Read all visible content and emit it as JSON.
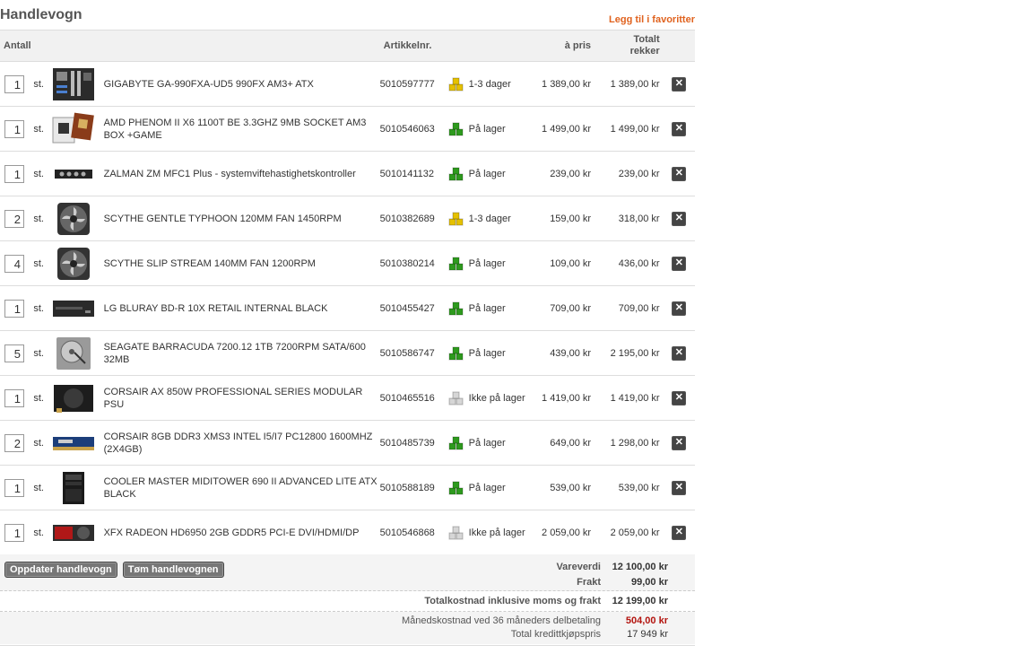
{
  "page": {
    "title": "Handlevogn",
    "favorite_link": "Legg til i favoritter"
  },
  "columns": {
    "qty": "Antall",
    "sku": "Artikkelnr.",
    "unit_price": "à pris",
    "total": "Totalt rekker"
  },
  "unit": "st.",
  "items": [
    {
      "qty": "1",
      "name": "GIGABYTE GA-990FXA-UD5 990FX AM3+ ATX",
      "sku": "5010597777",
      "stock": "1-3 dager",
      "stock_color": "#e5c100",
      "price": "1 389,00 kr",
      "total": "1 389,00 kr",
      "thumb": "motherboard"
    },
    {
      "qty": "1",
      "name": "AMD PHENOM II X6 1100T BE 3.3GHZ 9MB SOCKET AM3 BOX +GAME",
      "sku": "5010546063",
      "stock": "På lager",
      "stock_color": "#2e9a1e",
      "price": "1 499,00 kr",
      "total": "1 499,00 kr",
      "thumb": "cpu-box"
    },
    {
      "qty": "1",
      "name": "ZALMAN ZM MFC1 Plus - systemviftehastighetskontroller",
      "sku": "5010141132",
      "stock": "På lager",
      "stock_color": "#2e9a1e",
      "price": "239,00 kr",
      "total": "239,00 kr",
      "thumb": "fan-controller"
    },
    {
      "qty": "2",
      "name": "SCYTHE GENTLE TYPHOON 120MM FAN 1450RPM",
      "sku": "5010382689",
      "stock": "1-3 dager",
      "stock_color": "#e5c100",
      "price": "159,00 kr",
      "total": "318,00 kr",
      "thumb": "fan"
    },
    {
      "qty": "4",
      "name": "SCYTHE SLIP STREAM 140MM FAN 1200RPM",
      "sku": "5010380214",
      "stock": "På lager",
      "stock_color": "#2e9a1e",
      "price": "109,00 kr",
      "total": "436,00 kr",
      "thumb": "fan"
    },
    {
      "qty": "1",
      "name": "LG BLURAY BD-R 10X RETAIL INTERNAL BLACK",
      "sku": "5010455427",
      "stock": "På lager",
      "stock_color": "#2e9a1e",
      "price": "709,00 kr",
      "total": "709,00 kr",
      "thumb": "drive"
    },
    {
      "qty": "5",
      "name": "SEAGATE BARRACUDA 7200.12 1TB 7200RPM SATA/600 32MB",
      "sku": "5010586747",
      "stock": "På lager",
      "stock_color": "#2e9a1e",
      "price": "439,00 kr",
      "total": "2 195,00 kr",
      "thumb": "hdd"
    },
    {
      "qty": "1",
      "name": "CORSAIR AX 850W PROFESSIONAL SERIES MODULAR PSU",
      "sku": "5010465516",
      "stock": "Ikke på lager",
      "stock_color": "#d6d6d6",
      "price": "1 419,00 kr",
      "total": "1 419,00 kr",
      "thumb": "psu"
    },
    {
      "qty": "2",
      "name": "CORSAIR 8GB DDR3 XMS3 INTEL I5/I7 PC12800 1600MHZ (2X4GB)",
      "sku": "5010485739",
      "stock": "På lager",
      "stock_color": "#2e9a1e",
      "price": "649,00 kr",
      "total": "1 298,00 kr",
      "thumb": "ram"
    },
    {
      "qty": "1",
      "name": "COOLER MASTER MIDITOWER 690 II ADVANCED LITE ATX BLACK",
      "sku": "5010588189",
      "stock": "På lager",
      "stock_color": "#2e9a1e",
      "price": "539,00 kr",
      "total": "539,00 kr",
      "thumb": "case"
    },
    {
      "qty": "1",
      "name": "XFX RADEON HD6950 2GB GDDR5 PCI-E DVI/HDMI/DP",
      "sku": "5010546868",
      "stock": "Ikke på lager",
      "stock_color": "#d6d6d6",
      "price": "2 059,00 kr",
      "total": "2 059,00 kr",
      "thumb": "gpu"
    }
  ],
  "buttons": {
    "update": "Oppdater handlevogn",
    "empty": "Tøm handlevognen"
  },
  "summary": {
    "goods_label": "Vareverdi",
    "goods_value": "12 100,00 kr",
    "shipping_label": "Frakt",
    "shipping_value": "99,00 kr",
    "total_label": "Totalkostnad inklusive moms og frakt",
    "total_value": "12 199,00 kr",
    "monthly_label": "Månedskostnad ved 36 måneders delbetaling",
    "monthly_value": "504,00 kr",
    "credit_label": "Total kredittkjøpspris",
    "credit_value": "17 949 kr"
  },
  "colors": {
    "accent": "#e0621e",
    "monthly": "#b3140f"
  }
}
